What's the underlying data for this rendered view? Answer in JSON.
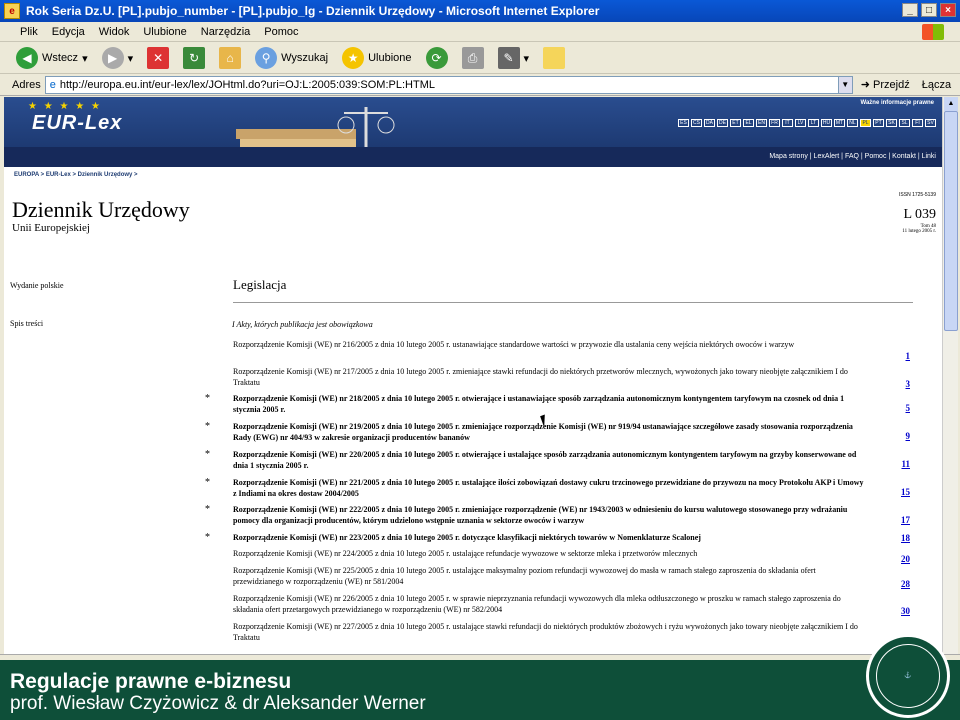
{
  "window": {
    "title": "Rok Seria Dz.U. [PL].pubjo_number - [PL].pubjo_lg - Dziennik Urzędowy - Microsoft Internet Explorer"
  },
  "menu": [
    "Plik",
    "Edycja",
    "Widok",
    "Ulubione",
    "Narzędzia",
    "Pomoc"
  ],
  "toolbar": {
    "back": "Wstecz",
    "search": "Wyszukaj",
    "favorites": "Ulubione"
  },
  "address": {
    "label": "Adres",
    "url": "http://europa.eu.int/eur-lex/lex/JOHtml.do?uri=OJ:L:2005:039:SOM:PL:HTML",
    "go": "Przejdź",
    "links": "Łącza"
  },
  "banner": {
    "logo": "EUR-Lex",
    "wazne": "Ważne informacje prawne",
    "langs": [
      "ES",
      "CS",
      "DA",
      "DE",
      "ET",
      "EL",
      "EN",
      "FR",
      "IT",
      "LV",
      "LT",
      "HU",
      "MT",
      "NL",
      "PL",
      "PT",
      "SK",
      "SL",
      "FI",
      "SV"
    ],
    "toplinks": "Mapa strony | LexAlert | FAQ | Pomoc | Kontakt | Linki"
  },
  "breadcrumb": "EUROPA > EUR-Lex > Dziennik Urzędowy >",
  "journal": {
    "title": "Dziennik Urzędowy",
    "subtitle": "Unii Europejskiej",
    "issn": "ISSN 1725-5139",
    "number": "L 039",
    "tom": "Tom 48",
    "date": "11 lutego 2005 r."
  },
  "wydanie": "Wydanie polskie",
  "legislacja": "Legislacja",
  "spis": "Spis treści",
  "section": "I   Akty, których publikacja jest obowiązkowa",
  "entries": [
    {
      "text": "Rozporządzenie Komisji (WE) nr 216/2005 z dnia 10 lutego 2005 r. ustanawiające standardowe wartości w przywozie dla ustalania ceny wejścia niektórych owoców i warzyw",
      "page": "1",
      "bold": false,
      "star": false
    },
    {
      "text": "Rozporządzenie Komisji (WE) nr 217/2005 z dnia 10 lutego 2005 r. zmieniające stawki refundacji do niektórych przetworów mlecznych, wywożonych jako towary nieobjęte załącznikiem I do Traktatu",
      "page": "3",
      "bold": false,
      "star": false
    },
    {
      "text": "Rozporządzenie Komisji (WE) nr 218/2005 z dnia 10 lutego 2005 r. otwierające i ustanawiające sposób zarządzania autonomicznym kontyngentem taryfowym na czosnek od dnia 1 stycznia 2005 r.",
      "page": "5",
      "bold": true,
      "star": true
    },
    {
      "text": "Rozporządzenie Komisji (WE) nr 219/2005 z dnia 10 lutego 2005 r. zmieniające rozporządzenie Komisji (WE) nr 919/94 ustanawiające szczegółowe zasady stosowania rozporządzenia Rady (EWG) nr 404/93 w zakresie organizacji producentów bananów",
      "page": "9",
      "bold": true,
      "star": true
    },
    {
      "text": "Rozporządzenie Komisji (WE) nr 220/2005 z dnia 10 lutego 2005 r. otwierające i ustalające sposób zarządzania autonomicznym kontyngentem taryfowym na grzyby konserwowane od dnia 1 stycznia 2005 r.",
      "page": "11",
      "bold": true,
      "star": true
    },
    {
      "text": "Rozporządzenie Komisji (WE) nr 221/2005 z dnia 10 lutego 2005 r. ustalające ilości zobowiązań dostawy cukru trzcinowego przewidziane do przywozu na mocy Protokołu AKP i Umowy z Indiami na okres dostaw 2004/2005",
      "page": "15",
      "bold": true,
      "star": true
    },
    {
      "text": "Rozporządzenie Komisji (WE) nr 222/2005 z dnia 10 lutego 2005 r. zmieniające rozporządzenie (WE) nr 1943/2003 w odniesieniu do kursu walutowego stosowanego przy wdrażaniu pomocy dla organizacji producentów, którym udzielono wstępnie uznania w sektorze owoców i warzyw",
      "page": "17",
      "bold": true,
      "star": true
    },
    {
      "text": "Rozporządzenie Komisji (WE) nr 223/2005 z dnia 10 lutego 2005 r. dotyczące klasyfikacji niektórych towarów w Nomenklaturze Scalonej",
      "page": "18",
      "bold": true,
      "star": true
    },
    {
      "text": "Rozporządzenie Komisji (WE) nr 224/2005 z dnia 10 lutego 2005 r. ustalające refundacje wywozowe w sektorze mleka i przetworów mlecznych",
      "page": "20",
      "bold": false,
      "star": false
    },
    {
      "text": "Rozporządzenie Komisji (WE) nr 225/2005 z dnia 10 lutego 2005 r. ustalające maksymalny poziom refundacji wywozowej do masła w ramach stałego zaproszenia do składania ofert przewidzianego w rozporządzeniu (WE) nr 581/2004",
      "page": "28",
      "bold": false,
      "star": false
    },
    {
      "text": "Rozporządzenie Komisji (WE) nr 226/2005 z dnia 10 lutego 2005 r. w sprawie nieprzyznania refundacji wywozowych dla mleka odtłuszczonego w proszku w ramach stałego zaproszenia do składania ofert przetargowych przewidzianego w rozporządzeniu (WE) nr 582/2004",
      "page": "30",
      "bold": false,
      "star": false
    },
    {
      "text": "Rozporządzenie Komisji (WE) nr 227/2005 z dnia 10 lutego 2005 r. ustalające stawki refundacji do niektórych produktów zbożowych i ryżu wywożonych jako towary nieobjęte załącznikiem I do Traktatu",
      "page": "",
      "bold": false,
      "star": false
    }
  ],
  "footer": {
    "line1": "Regulacje prawne e-biznesu",
    "line2": "prof. Wiesław Czyżowicz & dr Aleksander Werner"
  }
}
